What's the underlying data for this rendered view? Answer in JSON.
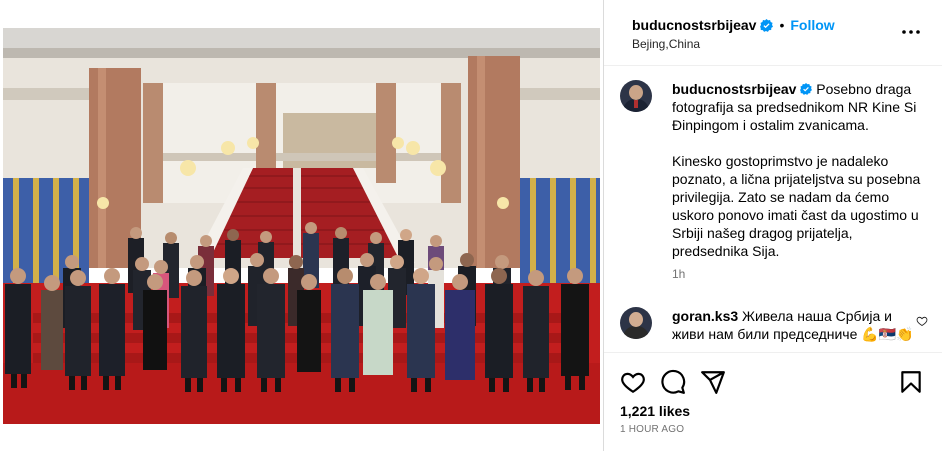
{
  "post": {
    "username": "buducnostsrbijeav",
    "follow_label": "Follow",
    "location": "Bejing,China",
    "caption": {
      "username": "buducnostsrbijeav",
      "text": "Posebno draga fotografija sa predsednikom NR Kine Si Đinpingom i ostalim zvanicama.\n\nKinesko gostoprimstvo je nadaleko poznato, a lična prijateljstva su posebna privilegija. Zato se nadam da ćemo uskoro ponovo imati čast da ugostimo u Srbiji našeg dragog prijatelja, predsednika Sija.",
      "time": "1h"
    },
    "comments": [
      {
        "username": "goran.ks3",
        "text": "Живела наша Србија и живи нам били председниче",
        "emoji": "💪🇷🇸👏"
      }
    ],
    "likes": "1,221 likes",
    "posted": "1 HOUR AGO"
  },
  "icons": {
    "verified": "verified-badge-icon",
    "more": "more-options-icon",
    "like": "heart-icon",
    "comment": "comment-icon",
    "share": "share-icon",
    "save": "bookmark-icon"
  },
  "colors": {
    "accent": "#0095f6",
    "verified": "#0095f6",
    "muted": "#737373",
    "carpet": "#c21e1e"
  }
}
